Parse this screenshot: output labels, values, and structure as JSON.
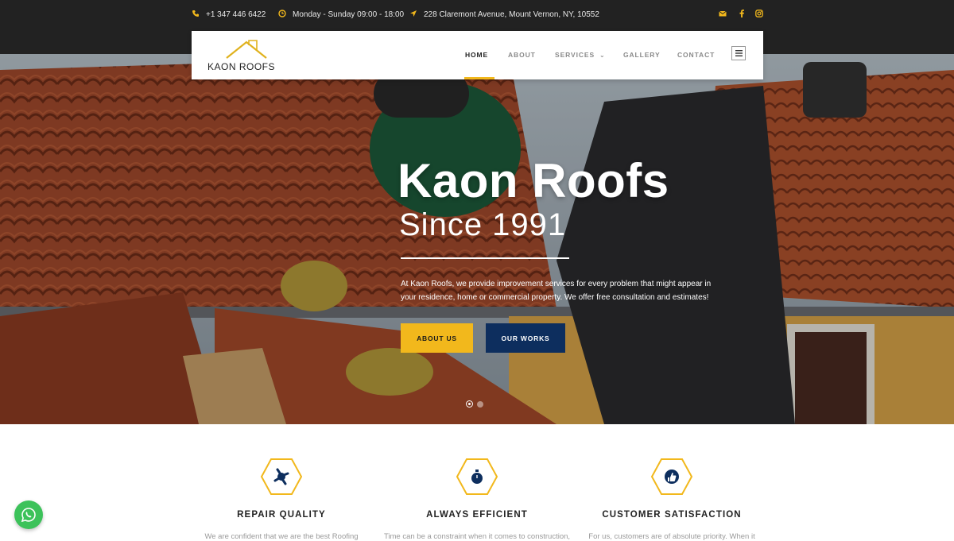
{
  "topbar": {
    "phone": "+1 347 446 6422",
    "hours": "Monday - Sunday 09:00 - 18:00",
    "address": "228 Claremont Avenue, Mount Vernon, NY, 10552",
    "icons": [
      "phone-icon",
      "clock-icon",
      "location-icon",
      "mail-icon",
      "facebook-icon",
      "instagram-icon"
    ]
  },
  "logo": {
    "text": "KAON ROOFS"
  },
  "nav": {
    "items": [
      {
        "label": "HOME",
        "active": true
      },
      {
        "label": "ABOUT"
      },
      {
        "label": "SERVICES"
      },
      {
        "label": "GALLERY"
      },
      {
        "label": "CONTACT"
      }
    ]
  },
  "hero": {
    "title": "Kaon Roofs",
    "subtitle": "Since 1991",
    "description": "At Kaon Roofs, we provide improvement services for every problem that might appear in your residence, home or commercial property. We offer free consultation and estimates!",
    "btn_about": "ABOUT US",
    "btn_works": "OUR WORKS",
    "slides": 2,
    "active_slide": 1
  },
  "features": [
    {
      "title": "REPAIR QUALITY",
      "text": "We are confident that we are the best Roofing",
      "icon": "repair-icon"
    },
    {
      "title": "ALWAYS EFFICIENT",
      "text": "Time can be a constraint when it comes to construction,",
      "icon": "stopwatch-icon"
    },
    {
      "title": "CUSTOMER SATISFACTION",
      "text": "For us, customers are of absolute priority. When it",
      "icon": "thumbs-up-icon"
    }
  ],
  "colors": {
    "accent": "#f2b81c",
    "navy": "#0d2e5e",
    "topbar": "#222222",
    "whatsapp": "#3cc25a"
  }
}
